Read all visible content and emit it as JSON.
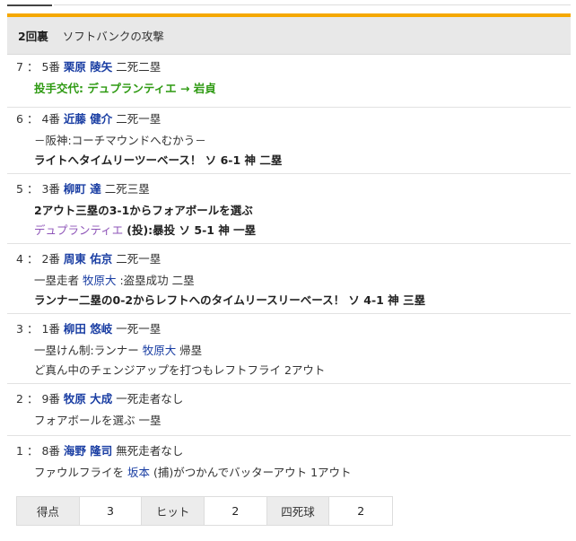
{
  "inning": {
    "label": "2回裏",
    "title": "ソフトバンクの攻撃"
  },
  "atbats": [
    {
      "seq": "7",
      "order": "5番",
      "batter": "栗原 陵矢",
      "outs_runners": "二死二塁",
      "substitution": {
        "prefix": "投手交代: ",
        "text": "デュプランティエ → 岩貞"
      }
    },
    {
      "seq": "6",
      "order": "4番",
      "batter": "近藤 健介",
      "outs_runners": "二死一塁",
      "note": "－阪神:コーチマウンドへむかう－",
      "result": "ライトへタイムリーツーベース！ ソ 6-1 神 二塁"
    },
    {
      "seq": "5",
      "order": "3番",
      "batter": "柳町 達",
      "outs_runners": "二死三塁",
      "result": "2アウト三塁の3-1からフォアボールを選ぶ",
      "pitcher": "デュプランティエ",
      "pitcher_result": "(投):暴投 ソ 5-1 神 一塁"
    },
    {
      "seq": "4",
      "order": "2番",
      "batter": "周東 佑京",
      "outs_runners": "二死一塁",
      "runner_pre": "一塁走者 ",
      "runner_name": "牧原大",
      "runner_post": " :盗塁成功 二塁",
      "result": "ランナー二塁の0-2からレフトへのタイムリースリーベース！ ソ 4-1 神 三塁"
    },
    {
      "seq": "3",
      "order": "1番",
      "batter": "柳田 悠岐",
      "outs_runners": "一死一塁",
      "runner_pre": "一塁けん制:ランナー ",
      "runner_name": "牧原大",
      "runner_post": " 帰塁",
      "plain": "ど真ん中のチェンジアップを打つもレフトフライ 2アウト"
    },
    {
      "seq": "2",
      "order": "9番",
      "batter": "牧原 大成",
      "outs_runners": "一死走者なし",
      "plain": "フォアボールを選ぶ 一塁"
    },
    {
      "seq": "1",
      "order": "8番",
      "batter": "海野 隆司",
      "outs_runners": "無死走者なし",
      "play_pre": "ファウルフライを ",
      "play_name": "坂本",
      "play_post": " (捕)がつかんでバッターアウト 1アウト"
    }
  ],
  "summary": {
    "runs_label": "得点",
    "runs": "3",
    "hits_label": "ヒット",
    "hits": "2",
    "bb_label": "四死球",
    "bb": "2"
  }
}
